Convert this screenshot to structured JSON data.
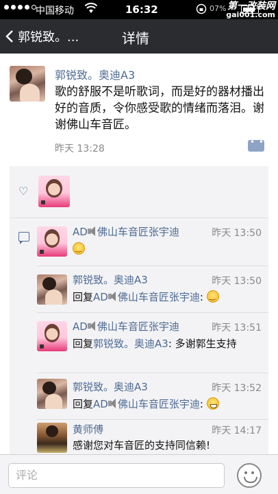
{
  "status_bar": {
    "carrier": "中国移动",
    "time": "16:32",
    "battery_text": "07%"
  },
  "watermark": {
    "line1": "第一改装网",
    "line2": "gai001.com"
  },
  "nav": {
    "back_label": "郭锐致。...",
    "title": "详情"
  },
  "post": {
    "author": "郭锐致。奥迪A3",
    "content": "歌的舒服不是听歌词，而是好的器材播出好的音质，令你感受歌的情绪而落泪。谢谢佛山车音匠。",
    "time": "昨天 13:28"
  },
  "comments": [
    {
      "author": "AD",
      "author_suffix": "佛山车音匠张宇迪",
      "time": "昨天 13:50"
    },
    {
      "author": "郭锐致。奥迪A3",
      "reply_prefix": "回复",
      "reply_to": "AD",
      "reply_to_suffix": "佛山车音匠张宇迪",
      "time": "昨天 13:50"
    },
    {
      "author": "AD",
      "author_suffix": "佛山车音匠张宇迪",
      "reply_prefix": "回复",
      "reply_to": "郭锐致。奥迪A3",
      "text": ": 多谢郭生支持",
      "time": "昨天 13:51"
    },
    {
      "author": "郭锐致。奥迪A3",
      "reply_prefix": "回复",
      "reply_to": "AD",
      "reply_to_suffix": "佛山车音匠张宇迪",
      "time": "昨天 13:52"
    },
    {
      "author": "黄师傅",
      "text": "感谢您对车音匠的支持同信赖!",
      "time": "昨天 14:17"
    }
  ],
  "input": {
    "placeholder": "评论"
  }
}
